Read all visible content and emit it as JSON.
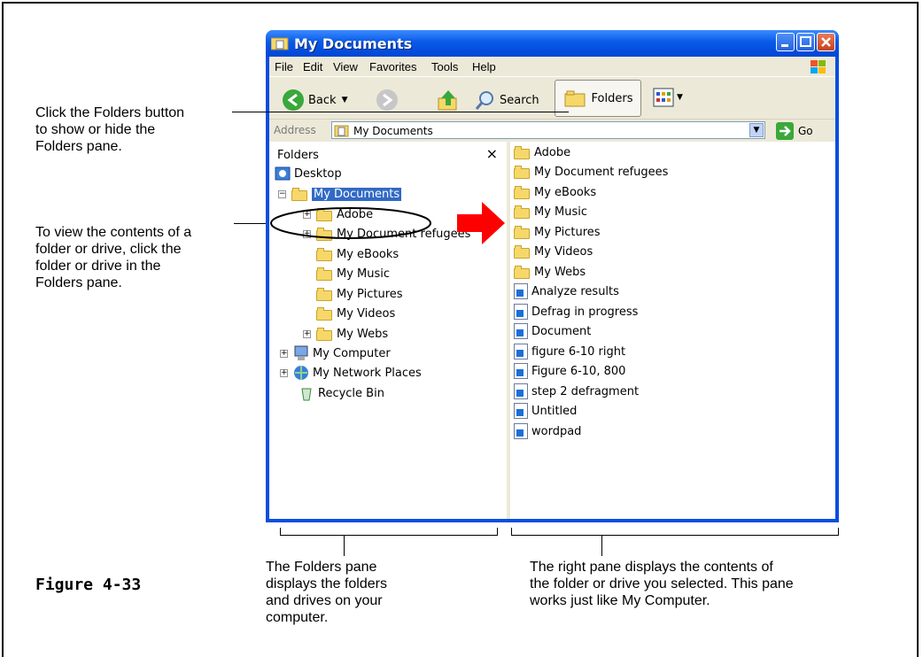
{
  "callouts": {
    "folders_button": "Click the Folders button\nto show or hide the\nFolders pane.",
    "view_contents": "To view the contents of a\nfolder or drive, click the\nfolder or drive in the\nFolders pane.",
    "folders_pane": "The Folders pane\ndisplays the folders\nand drives on your\ncomputer.",
    "right_pane": "The right pane displays the contents of\nthe folder or drive you selected. This pane\nworks just like My Computer."
  },
  "figure_label": "Figure 4-33",
  "window": {
    "title": "My Documents",
    "menu": [
      "File",
      "Edit",
      "View",
      "Favorites",
      "Tools",
      "Help"
    ],
    "toolbar": {
      "back": "Back",
      "search": "Search",
      "folders": "Folders"
    },
    "address": {
      "label": "Address",
      "value": "My Documents",
      "go": "Go"
    },
    "folders_pane": {
      "title": "Folders",
      "close": "×",
      "tree": [
        "Desktop",
        "My Documents",
        "Adobe",
        "My Document refugees",
        "My eBooks",
        "My Music",
        "My Pictures",
        "My Videos",
        "My Webs",
        "My Computer",
        "My Network Places",
        "Recycle Bin"
      ]
    },
    "files": [
      "Adobe",
      "My Document refugees",
      "My eBooks",
      "My Music",
      "My Pictures",
      "My Videos",
      "My Webs",
      "Analyze results",
      "Defrag in progress",
      "Document",
      "figure 6-10 right",
      "Figure 6-10, 800",
      "step 2 defragment",
      "Untitled",
      "wordpad"
    ]
  },
  "colors": {
    "xp_blue": "#0a4de0",
    "selection": "#316ac5",
    "arrow": "#ff0000"
  }
}
